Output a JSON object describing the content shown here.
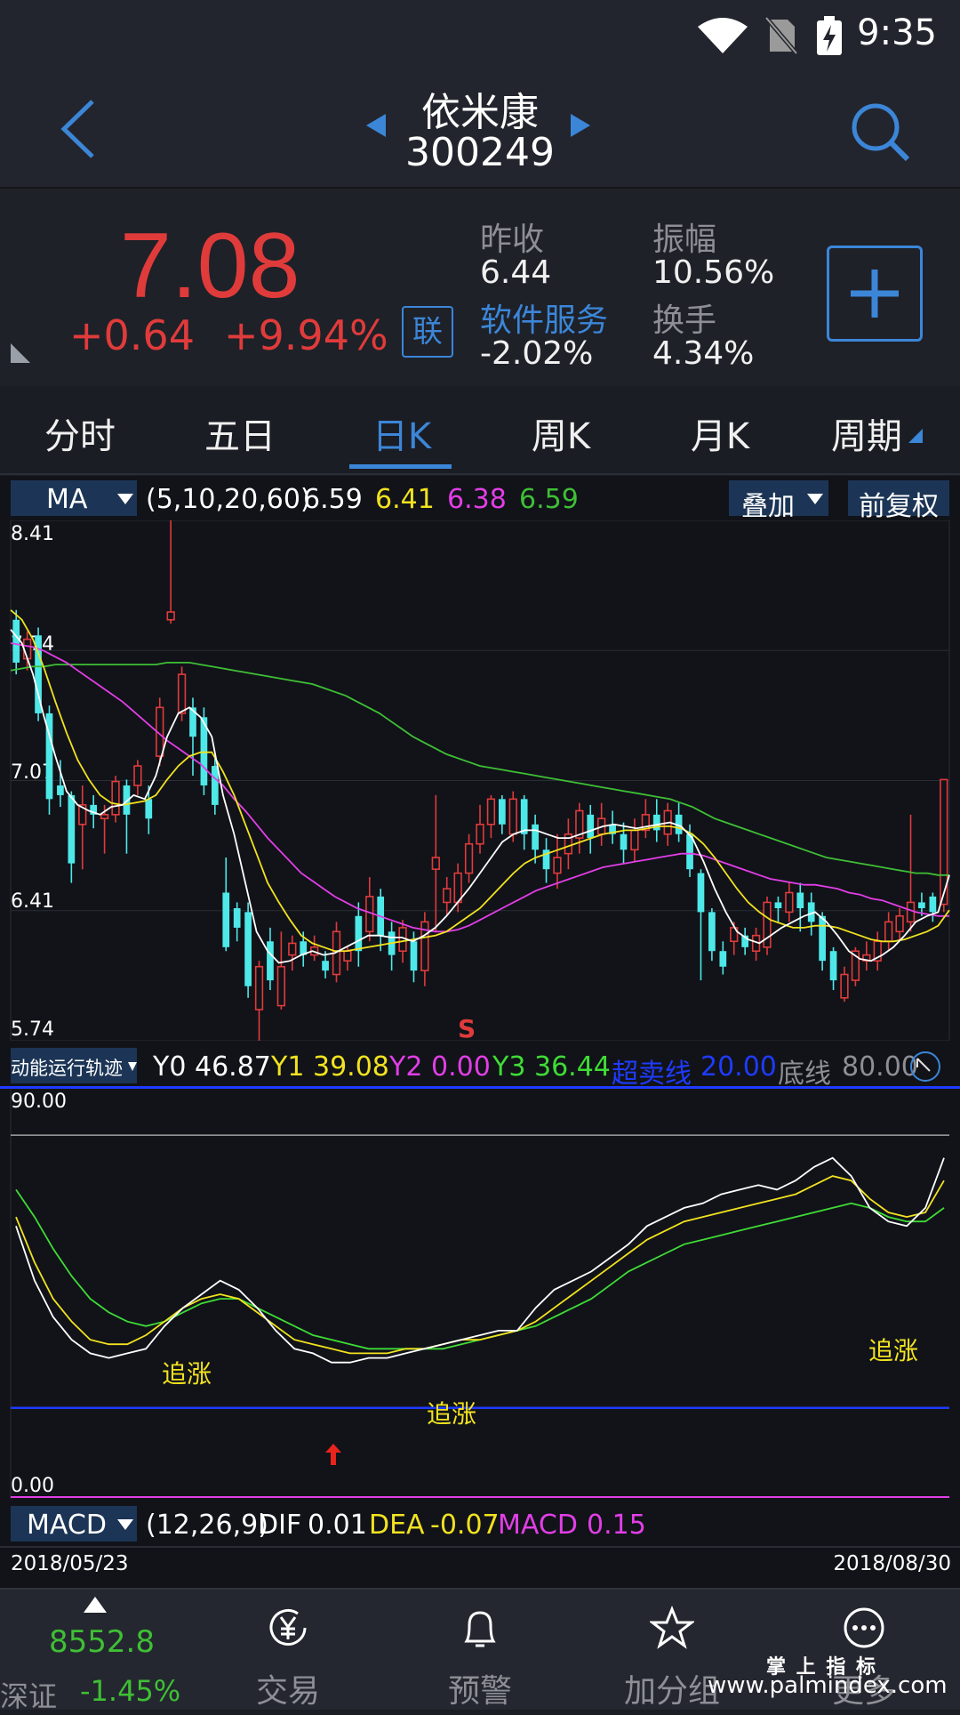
{
  "status_bar": {
    "time": "9:35"
  },
  "header": {
    "stock_name": "依米康",
    "stock_code": "300249"
  },
  "quote": {
    "price": "7.08",
    "change": "+0.64",
    "change_pct": "+9.94%",
    "lian_badge": "联",
    "prev_close_label": "昨收",
    "prev_close": "6.44",
    "sector_label": "软件服务",
    "sector_change": "-2.02%",
    "amplitude_label": "振幅",
    "amplitude": "10.56%",
    "turnover_label": "换手",
    "turnover": "4.34%"
  },
  "tabs": [
    {
      "label": "分时"
    },
    {
      "label": "五日"
    },
    {
      "label": "日K"
    },
    {
      "label": "周K"
    },
    {
      "label": "月K"
    },
    {
      "label": "周期"
    }
  ],
  "active_tab": "日K",
  "ma_bar": {
    "selector": "MA",
    "params": "(5,10,20,60)",
    "ma5": "6.59",
    "ma10": "6.41",
    "ma20": "6.38",
    "ma60": "6.59",
    "overlay_label": "叠加",
    "adjust_label": "前复权"
  },
  "colors": {
    "up": "#e03b3b",
    "down": "#4ee8e8",
    "ma5": "#ffffff",
    "ma10": "#f2e21f",
    "ma20": "#e23ee6",
    "ma60": "#3fbf35",
    "accent": "#3c86d8"
  },
  "price_axis": {
    "top": "8.41",
    "l2": "7.74",
    "l3": "7.07",
    "l4": "6.41",
    "bottom": "5.74"
  },
  "signal_s": "S",
  "indicator_bar": {
    "selector": "动能运行轨迹",
    "y0_label": "Y0",
    "y0": "46.87",
    "y1_label": "Y1",
    "y1": "39.08",
    "y2_label": "Y2",
    "y2": "0.00",
    "y3_label": "Y3",
    "y3": "36.44",
    "oversold_label": "超卖线",
    "oversold": "20.00",
    "bottom_label": "底线",
    "bottom": "80.00"
  },
  "indicator_axis": {
    "top": "90.00",
    "bottom": "0.00"
  },
  "chase_labels": [
    "追涨",
    "追涨",
    "追涨"
  ],
  "macd_bar": {
    "selector": "MACD",
    "params": "(12,26,9)",
    "dif_label": "DIF",
    "dif": "0.01",
    "dea_label": "DEA",
    "dea": "-0.07",
    "macd_label": "MACD",
    "macd": "0.15"
  },
  "dates": {
    "start": "2018/05/23",
    "end": "2018/08/30"
  },
  "bottom_nav": {
    "index_value": "8552.8",
    "index_name": "深证",
    "index_change": "-1.45%",
    "items": [
      {
        "label": "交易",
        "icon": "yen-icon"
      },
      {
        "label": "预警",
        "icon": "bell-icon"
      },
      {
        "label": "加分组",
        "icon": "star-icon"
      },
      {
        "label": "更多",
        "icon": "more-icon"
      }
    ]
  },
  "watermark": {
    "line1": "掌 上 指 标",
    "line2": "www.palmindex.com"
  },
  "chart_data": {
    "type": "candlestick",
    "title": "",
    "y_range": [
      5.74,
      8.41
    ],
    "start_date": "2018/05/23",
    "end_date": "2018/08/30",
    "candles": [
      {
        "o": 7.9,
        "c": 7.68,
        "h": 7.95,
        "l": 7.62
      },
      {
        "o": 7.7,
        "c": 7.8,
        "h": 7.84,
        "l": 7.64
      },
      {
        "o": 7.82,
        "c": 7.42,
        "h": 7.86,
        "l": 7.38
      },
      {
        "o": 7.42,
        "c": 6.98,
        "h": 7.46,
        "l": 6.9
      },
      {
        "o": 7.05,
        "c": 7.0,
        "h": 7.18,
        "l": 6.94
      },
      {
        "o": 7.0,
        "c": 6.65,
        "h": 7.02,
        "l": 6.55
      },
      {
        "o": 6.85,
        "c": 6.95,
        "h": 7.05,
        "l": 6.62
      },
      {
        "o": 6.95,
        "c": 6.9,
        "h": 7.0,
        "l": 6.83
      },
      {
        "o": 6.88,
        "c": 6.9,
        "h": 6.95,
        "l": 6.7
      },
      {
        "o": 6.9,
        "c": 7.07,
        "h": 7.1,
        "l": 6.86
      },
      {
        "o": 7.05,
        "c": 6.9,
        "h": 7.08,
        "l": 6.7
      },
      {
        "o": 7.05,
        "c": 7.15,
        "h": 7.18,
        "l": 7.0
      },
      {
        "o": 6.98,
        "c": 6.88,
        "h": 7.05,
        "l": 6.8
      },
      {
        "o": 7.2,
        "c": 7.45,
        "h": 7.5,
        "l": 7.15
      },
      {
        "o": 7.9,
        "c": 7.94,
        "h": 8.41,
        "l": 7.88
      },
      {
        "o": 7.42,
        "c": 7.62,
        "h": 7.66,
        "l": 7.38
      },
      {
        "o": 7.45,
        "c": 7.3,
        "h": 7.5,
        "l": 7.1
      },
      {
        "o": 7.4,
        "c": 7.05,
        "h": 7.45,
        "l": 7.0
      },
      {
        "o": 7.15,
        "c": 6.95,
        "h": 7.2,
        "l": 6.9
      },
      {
        "o": 6.5,
        "c": 6.22,
        "h": 6.68,
        "l": 6.2
      },
      {
        "o": 6.42,
        "c": 6.32,
        "h": 6.45,
        "l": 6.25
      },
      {
        "o": 6.4,
        "c": 6.02,
        "h": 6.45,
        "l": 5.96
      },
      {
        "o": 5.9,
        "c": 6.12,
        "h": 6.15,
        "l": 5.74
      },
      {
        "o": 6.25,
        "c": 6.05,
        "h": 6.32,
        "l": 6.0
      },
      {
        "o": 5.92,
        "c": 6.12,
        "h": 6.3,
        "l": 5.9
      },
      {
        "o": 6.18,
        "c": 6.24,
        "h": 6.28,
        "l": 6.1
      },
      {
        "o": 6.25,
        "c": 6.18,
        "h": 6.3,
        "l": 6.12
      },
      {
        "o": 6.18,
        "c": 6.22,
        "h": 6.28,
        "l": 6.15
      },
      {
        "o": 6.15,
        "c": 6.1,
        "h": 6.2,
        "l": 6.06
      },
      {
        "o": 6.08,
        "c": 6.3,
        "h": 6.35,
        "l": 6.04
      },
      {
        "o": 6.15,
        "c": 6.2,
        "h": 6.22,
        "l": 6.1
      },
      {
        "o": 6.38,
        "c": 6.2,
        "h": 6.45,
        "l": 6.12
      },
      {
        "o": 6.3,
        "c": 6.48,
        "h": 6.58,
        "l": 6.25
      },
      {
        "o": 6.48,
        "c": 6.28,
        "h": 6.52,
        "l": 6.2
      },
      {
        "o": 6.3,
        "c": 6.18,
        "h": 6.35,
        "l": 6.1
      },
      {
        "o": 6.2,
        "c": 6.32,
        "h": 6.36,
        "l": 6.14
      },
      {
        "o": 6.25,
        "c": 6.1,
        "h": 6.3,
        "l": 6.04
      },
      {
        "o": 6.1,
        "c": 6.35,
        "h": 6.4,
        "l": 6.02
      },
      {
        "o": 6.62,
        "c": 6.68,
        "h": 7.0,
        "l": 6.3
      },
      {
        "o": 6.45,
        "c": 6.52,
        "h": 6.58,
        "l": 6.38
      },
      {
        "o": 6.45,
        "c": 6.6,
        "h": 6.65,
        "l": 6.4
      },
      {
        "o": 6.6,
        "c": 6.75,
        "h": 6.8,
        "l": 6.55
      },
      {
        "o": 6.75,
        "c": 6.85,
        "h": 6.95,
        "l": 6.7
      },
      {
        "o": 6.85,
        "c": 6.98,
        "h": 7.0,
        "l": 6.78
      },
      {
        "o": 6.98,
        "c": 6.85,
        "h": 7.0,
        "l": 6.8
      },
      {
        "o": 6.8,
        "c": 6.98,
        "h": 7.02,
        "l": 6.76
      },
      {
        "o": 6.98,
        "c": 6.8,
        "h": 7.0,
        "l": 6.72
      },
      {
        "o": 6.85,
        "c": 6.72,
        "h": 6.9,
        "l": 6.65
      },
      {
        "o": 6.72,
        "c": 6.62,
        "h": 6.78,
        "l": 6.55
      },
      {
        "o": 6.6,
        "c": 6.68,
        "h": 6.8,
        "l": 6.52
      },
      {
        "o": 6.7,
        "c": 6.8,
        "h": 6.88,
        "l": 6.62
      },
      {
        "o": 6.78,
        "c": 6.92,
        "h": 6.96,
        "l": 6.7
      },
      {
        "o": 6.9,
        "c": 6.78,
        "h": 6.95,
        "l": 6.7
      },
      {
        "o": 6.8,
        "c": 6.88,
        "h": 6.96,
        "l": 6.74
      },
      {
        "o": 6.85,
        "c": 6.8,
        "h": 6.92,
        "l": 6.75
      },
      {
        "o": 6.8,
        "c": 6.72,
        "h": 6.86,
        "l": 6.65
      },
      {
        "o": 6.72,
        "c": 6.82,
        "h": 6.88,
        "l": 6.66
      },
      {
        "o": 6.82,
        "c": 6.9,
        "h": 6.98,
        "l": 6.78
      },
      {
        "o": 6.9,
        "c": 6.82,
        "h": 6.98,
        "l": 6.76
      },
      {
        "o": 6.8,
        "c": 6.92,
        "h": 6.96,
        "l": 6.74
      },
      {
        "o": 6.9,
        "c": 6.8,
        "h": 6.96,
        "l": 6.76
      },
      {
        "o": 6.8,
        "c": 6.62,
        "h": 6.85,
        "l": 6.58
      },
      {
        "o": 6.6,
        "c": 6.4,
        "h": 6.62,
        "l": 6.05
      },
      {
        "o": 6.4,
        "c": 6.2,
        "h": 6.42,
        "l": 6.15
      },
      {
        "o": 6.2,
        "c": 6.12,
        "h": 6.25,
        "l": 6.08
      },
      {
        "o": 6.25,
        "c": 6.32,
        "h": 6.35,
        "l": 6.18
      },
      {
        "o": 6.28,
        "c": 6.22,
        "h": 6.32,
        "l": 6.18
      },
      {
        "o": 6.2,
        "c": 6.28,
        "h": 6.32,
        "l": 6.15
      },
      {
        "o": 6.22,
        "c": 6.45,
        "h": 6.48,
        "l": 6.18
      },
      {
        "o": 6.45,
        "c": 6.42,
        "h": 6.48,
        "l": 6.35
      },
      {
        "o": 6.4,
        "c": 6.5,
        "h": 6.55,
        "l": 6.35
      },
      {
        "o": 6.5,
        "c": 6.42,
        "h": 6.55,
        "l": 6.3
      },
      {
        "o": 6.45,
        "c": 6.35,
        "h": 6.5,
        "l": 6.28
      },
      {
        "o": 6.38,
        "c": 6.15,
        "h": 6.4,
        "l": 6.1
      },
      {
        "o": 6.2,
        "c": 6.05,
        "h": 6.22,
        "l": 6.0
      },
      {
        "o": 5.96,
        "c": 6.08,
        "h": 6.12,
        "l": 5.94
      },
      {
        "o": 6.05,
        "c": 6.2,
        "h": 6.22,
        "l": 6.02
      },
      {
        "o": 6.15,
        "c": 6.18,
        "h": 6.25,
        "l": 6.1
      },
      {
        "o": 6.15,
        "c": 6.25,
        "h": 6.3,
        "l": 6.1
      },
      {
        "o": 6.25,
        "c": 6.35,
        "h": 6.4,
        "l": 6.2
      },
      {
        "o": 6.3,
        "c": 6.38,
        "h": 6.42,
        "l": 6.25
      },
      {
        "o": 6.35,
        "c": 6.45,
        "h": 6.9,
        "l": 6.3
      },
      {
        "o": 6.45,
        "c": 6.42,
        "h": 6.5,
        "l": 6.38
      },
      {
        "o": 6.48,
        "c": 6.4,
        "h": 6.5,
        "l": 6.35
      },
      {
        "o": 6.44,
        "c": 7.08,
        "h": 7.08,
        "l": 6.4
      }
    ],
    "ma5": [
      7.85,
      7.78,
      7.62,
      7.4,
      7.2,
      7.02,
      6.95,
      6.92,
      6.9,
      6.94,
      6.95,
      7.0,
      6.98,
      7.1,
      7.3,
      7.42,
      7.45,
      7.4,
      7.3,
      7.0,
      6.8,
      6.55,
      6.3,
      6.2,
      6.14,
      6.15,
      6.18,
      6.2,
      6.18,
      6.19,
      6.22,
      6.25,
      6.28,
      6.28,
      6.27,
      6.27,
      6.25,
      6.28,
      6.32,
      6.38,
      6.45,
      6.52,
      6.6,
      6.68,
      6.76,
      6.8,
      6.82,
      6.82,
      6.8,
      6.78,
      6.78,
      6.8,
      6.82,
      6.84,
      6.85,
      6.84,
      6.83,
      6.84,
      6.85,
      6.86,
      6.84,
      6.78,
      6.66,
      6.52,
      6.4,
      6.3,
      6.26,
      6.24,
      6.28,
      6.32,
      6.35,
      6.38,
      6.4,
      6.35,
      6.28,
      6.2,
      6.16,
      6.15,
      6.18,
      6.22,
      6.28,
      6.35,
      6.38,
      6.4,
      6.59
    ],
    "ma10": [
      7.95,
      7.9,
      7.8,
      7.65,
      7.48,
      7.32,
      7.18,
      7.08,
      7.0,
      6.96,
      6.95,
      6.96,
      6.97,
      7.0,
      7.08,
      7.15,
      7.2,
      7.22,
      7.22,
      7.12,
      7.0,
      6.85,
      6.7,
      6.55,
      6.45,
      6.36,
      6.28,
      6.24,
      6.22,
      6.2,
      6.2,
      6.21,
      6.22,
      6.23,
      6.24,
      6.25,
      6.26,
      6.27,
      6.28,
      6.3,
      6.34,
      6.38,
      6.42,
      6.48,
      6.54,
      6.6,
      6.65,
      6.68,
      6.7,
      6.72,
      6.74,
      6.76,
      6.78,
      6.8,
      6.81,
      6.82,
      6.82,
      6.83,
      6.84,
      6.84,
      6.83,
      6.8,
      6.75,
      6.68,
      6.6,
      6.52,
      6.45,
      6.4,
      6.36,
      6.34,
      6.32,
      6.32,
      6.33,
      6.33,
      6.32,
      6.3,
      6.28,
      6.26,
      6.25,
      6.25,
      6.26,
      6.28,
      6.3,
      6.33,
      6.41
    ],
    "ma20": [
      7.78,
      7.77,
      7.76,
      7.74,
      7.71,
      7.68,
      7.64,
      7.6,
      7.56,
      7.52,
      7.48,
      7.43,
      7.38,
      7.33,
      7.28,
      7.24,
      7.2,
      7.16,
      7.1,
      7.05,
      6.98,
      6.92,
      6.85,
      6.78,
      6.72,
      6.66,
      6.6,
      6.56,
      6.52,
      6.48,
      6.45,
      6.42,
      6.4,
      6.38,
      6.36,
      6.34,
      6.32,
      6.31,
      6.3,
      6.3,
      6.31,
      6.33,
      6.36,
      6.39,
      6.42,
      6.45,
      6.48,
      6.51,
      6.53,
      6.55,
      6.57,
      6.59,
      6.61,
      6.63,
      6.64,
      6.65,
      6.66,
      6.67,
      6.68,
      6.69,
      6.7,
      6.7,
      6.69,
      6.67,
      6.65,
      6.63,
      6.61,
      6.59,
      6.57,
      6.56,
      6.55,
      6.54,
      6.54,
      6.53,
      6.52,
      6.5,
      6.49,
      6.47,
      6.46,
      6.44,
      6.42,
      6.4,
      6.39,
      6.38,
      6.38
    ],
    "ma60": [
      7.64,
      7.65,
      7.66,
      7.66,
      7.67,
      7.67,
      7.67,
      7.67,
      7.67,
      7.67,
      7.67,
      7.67,
      7.67,
      7.67,
      7.68,
      7.68,
      7.68,
      7.67,
      7.66,
      7.65,
      7.64,
      7.63,
      7.62,
      7.61,
      7.6,
      7.59,
      7.58,
      7.57,
      7.55,
      7.53,
      7.51,
      7.48,
      7.45,
      7.42,
      7.38,
      7.34,
      7.3,
      7.27,
      7.24,
      7.21,
      7.19,
      7.17,
      7.15,
      7.14,
      7.13,
      7.12,
      7.11,
      7.1,
      7.09,
      7.08,
      7.07,
      7.06,
      7.05,
      7.04,
      7.03,
      7.02,
      7.01,
      7.0,
      6.99,
      6.98,
      6.96,
      6.94,
      6.91,
      6.88,
      6.86,
      6.84,
      6.82,
      6.8,
      6.78,
      6.76,
      6.74,
      6.72,
      6.7,
      6.68,
      6.67,
      6.66,
      6.65,
      6.64,
      6.63,
      6.62,
      6.61,
      6.6,
      6.6,
      6.59,
      6.59
    ],
    "indicator_range": [
      0,
      90
    ],
    "indicator_white": [
      60,
      48,
      40,
      35,
      32,
      31,
      32,
      33,
      38,
      42,
      45,
      48,
      46,
      42,
      37,
      33,
      32,
      30,
      30,
      31,
      31,
      32,
      33,
      34,
      35,
      36,
      37,
      37,
      42,
      46,
      48,
      50,
      53,
      56,
      60,
      62,
      64,
      65,
      67,
      68,
      69,
      68,
      70,
      73,
      75,
      71,
      64,
      61,
      60,
      64,
      75
    ],
    "indicator_yellow": [
      62,
      52,
      44,
      39,
      35,
      34,
      34,
      36,
      39,
      42,
      44,
      45,
      44,
      41,
      38,
      35,
      34,
      33,
      32,
      32,
      32,
      33,
      33,
      34,
      35,
      35,
      36,
      37,
      39,
      42,
      45,
      48,
      51,
      54,
      57,
      59,
      61,
      62,
      63,
      64,
      65,
      66,
      67,
      69,
      71,
      70,
      66,
      63,
      62,
      63,
      70
    ],
    "indicator_green": [
      68,
      62,
      55,
      49,
      44,
      41,
      39,
      38,
      39,
      41,
      43,
      44,
      44,
      42,
      40,
      38,
      36,
      35,
      34,
      33,
      33,
      33,
      33,
      33,
      34,
      35,
      36,
      37,
      38,
      40,
      42,
      44,
      47,
      50,
      52,
      54,
      56,
      57,
      58,
      59,
      60,
      61,
      62,
      63,
      64,
      65,
      64,
      62,
      61,
      61,
      64
    ],
    "oversold_level": 20,
    "bottom_level": 80
  }
}
